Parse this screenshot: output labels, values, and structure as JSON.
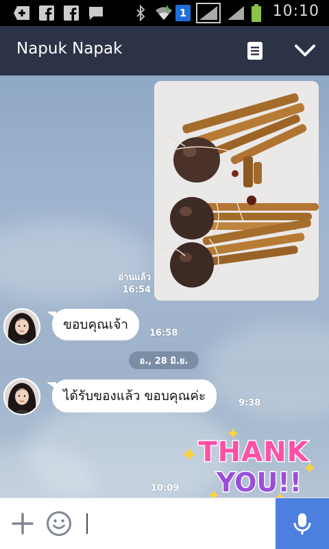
{
  "status_bar": {
    "time": "10:10",
    "sim_badge": "1",
    "icons": [
      "add-square-icon",
      "facebook-icon",
      "facebook-icon",
      "chat-bubble-icon",
      "bluetooth-icon",
      "wifi-icon",
      "sim-badge-icon",
      "signal-icon",
      "signal-icon",
      "battery-icon"
    ]
  },
  "header": {
    "title": "Napuk Napak",
    "icons": [
      "notes-icon",
      "chevron-down-icon"
    ]
  },
  "messages": [
    {
      "type": "photo",
      "side": "sent",
      "status": "อ่านแล้ว",
      "time": "16:54"
    },
    {
      "type": "text",
      "side": "received",
      "text": "ขอบคุณเจ้า",
      "time": "16:58"
    },
    {
      "type": "date",
      "text": "อ., 28 มิ.ย."
    },
    {
      "type": "text",
      "side": "received",
      "text": "ได้รับของแล้ว ขอบคุณค่ะ",
      "time": "9:38"
    },
    {
      "type": "sticker",
      "side": "sent",
      "line1": "THANK",
      "line2": "YOU!!",
      "time": "10:09"
    }
  ],
  "input_bar": {
    "value": "",
    "icons": [
      "plus-icon",
      "emoji-icon",
      "mic-icon"
    ]
  },
  "colors": {
    "header_bg": "#2c3346",
    "mic_bg": "#4d7fe0",
    "chat_bg": "#9cb2cd",
    "sticker_pink": "#ff4fa8",
    "sticker_purple": "#9b4fd8"
  }
}
